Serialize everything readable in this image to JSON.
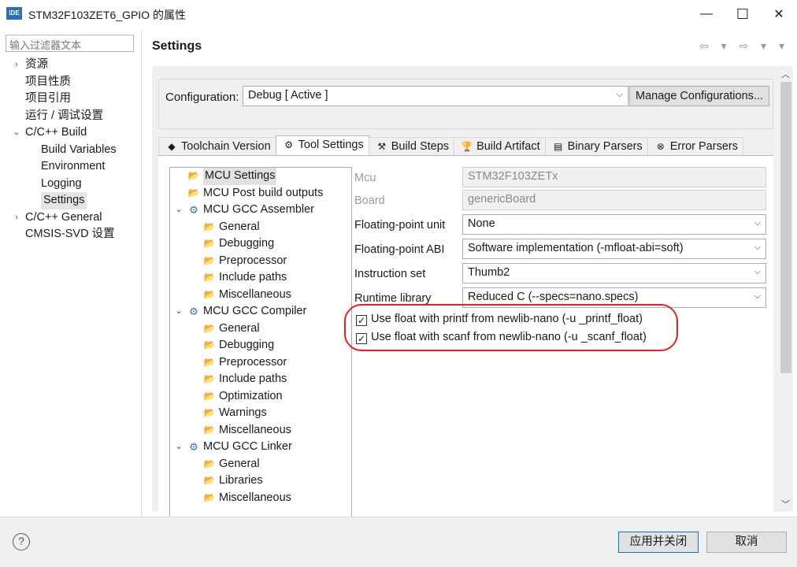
{
  "window": {
    "app_icon": "IDE",
    "title": "STM32F103ZET6_GPIO 的属性",
    "minimize": "—",
    "maximize": "☐",
    "close": "✕"
  },
  "filter": {
    "placeholder": "输入过滤器文本"
  },
  "nav": [
    {
      "label": "资源",
      "twisty": "›",
      "level": 0
    },
    {
      "label": "项目性质",
      "twisty": "",
      "level": 0
    },
    {
      "label": "项目引用",
      "twisty": "",
      "level": 0
    },
    {
      "label": "运行 / 调试设置",
      "twisty": "",
      "level": 0
    },
    {
      "label": "C/C++ Build",
      "twisty": "⌄",
      "level": 0
    },
    {
      "label": "Build Variables",
      "twisty": "",
      "level": 1
    },
    {
      "label": "Environment",
      "twisty": "",
      "level": 1
    },
    {
      "label": "Logging",
      "twisty": "",
      "level": 1
    },
    {
      "label": "Settings",
      "twisty": "",
      "level": 1,
      "selected": true
    },
    {
      "label": "C/C++ General",
      "twisty": "›",
      "level": 0
    },
    {
      "label": "CMSIS-SVD 设置",
      "twisty": "",
      "level": 0
    }
  ],
  "page": {
    "title": "Settings",
    "nav_arrows": "⇦ ▾ ⇨ ▾ ▾"
  },
  "configuration": {
    "label": "Configuration:",
    "value": "Debug  [ Active ]",
    "manage_button": "Manage Configurations..."
  },
  "tabs": [
    {
      "label": "Toolchain  Version",
      "icon": "◆",
      "active": false
    },
    {
      "label": "Tool Settings",
      "icon": "⚙",
      "active": true
    },
    {
      "label": "Build Steps",
      "icon": "⚒",
      "active": false
    },
    {
      "label": "Build Artifact",
      "icon": "🏆",
      "active": false
    },
    {
      "label": "Binary Parsers",
      "icon": "▤",
      "active": false
    },
    {
      "label": "Error Parsers",
      "icon": "⊗",
      "active": false
    }
  ],
  "tool_tree": [
    {
      "label": "MCU Settings",
      "level": 0,
      "twisty": "",
      "selected": true
    },
    {
      "label": "MCU Post build outputs",
      "level": 0,
      "twisty": ""
    },
    {
      "label": "MCU GCC Assembler",
      "level": 0,
      "twisty": "⌄"
    },
    {
      "label": "General",
      "level": 1,
      "twisty": ""
    },
    {
      "label": "Debugging",
      "level": 1,
      "twisty": ""
    },
    {
      "label": "Preprocessor",
      "level": 1,
      "twisty": ""
    },
    {
      "label": "Include paths",
      "level": 1,
      "twisty": ""
    },
    {
      "label": "Miscellaneous",
      "level": 1,
      "twisty": ""
    },
    {
      "label": "MCU GCC Compiler",
      "level": 0,
      "twisty": "⌄"
    },
    {
      "label": "General",
      "level": 1,
      "twisty": ""
    },
    {
      "label": "Debugging",
      "level": 1,
      "twisty": ""
    },
    {
      "label": "Preprocessor",
      "level": 1,
      "twisty": ""
    },
    {
      "label": "Include paths",
      "level": 1,
      "twisty": ""
    },
    {
      "label": "Optimization",
      "level": 1,
      "twisty": ""
    },
    {
      "label": "Warnings",
      "level": 1,
      "twisty": ""
    },
    {
      "label": "Miscellaneous",
      "level": 1,
      "twisty": ""
    },
    {
      "label": "MCU GCC Linker",
      "level": 0,
      "twisty": "⌄"
    },
    {
      "label": "General",
      "level": 1,
      "twisty": ""
    },
    {
      "label": "Libraries",
      "level": 1,
      "twisty": ""
    },
    {
      "label": "Miscellaneous",
      "level": 1,
      "twisty": ""
    }
  ],
  "props": {
    "mcu": {
      "label": "Mcu",
      "value": "STM32F103ZETx"
    },
    "board": {
      "label": "Board",
      "value": "genericBoard"
    },
    "fpu": {
      "label": "Floating-point unit",
      "value": "None"
    },
    "fpabi": {
      "label": "Floating-point ABI",
      "value": "Software implementation (-mfloat-abi=soft)"
    },
    "iset": {
      "label": "Instruction set",
      "value": "Thumb2"
    },
    "runtime": {
      "label": "Runtime library",
      "value": "Reduced C (--specs=nano.specs)"
    },
    "printf_float": {
      "label": "Use float with printf from newlib-nano (-u _printf_float)",
      "checked": "✓"
    },
    "scanf_float": {
      "label": "Use float with scanf from newlib-nano (-u _scanf_float)",
      "checked": "✓"
    }
  },
  "footer": {
    "help": "?",
    "apply_close": "应用并关闭",
    "cancel": "取消"
  },
  "colors": {
    "highlight_oval": "#d22222",
    "accent": "#2a6fb7"
  }
}
